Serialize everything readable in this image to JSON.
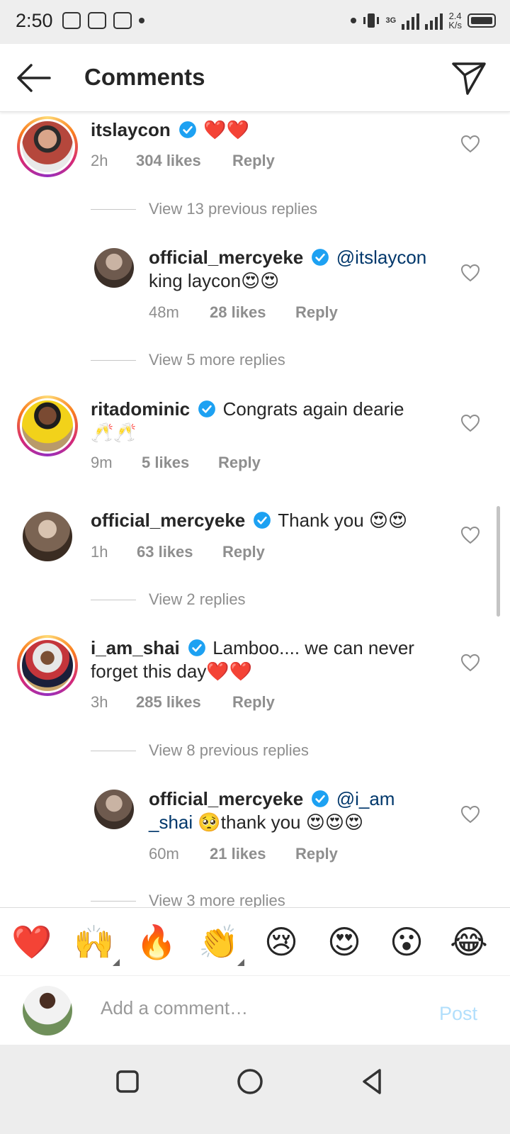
{
  "status": {
    "time": "2:50",
    "speed_value": "2.4",
    "speed_unit": "K/s",
    "network": "3G"
  },
  "header": {
    "title": "Comments"
  },
  "comments": [
    {
      "username": "itslaycon",
      "text": "❤️❤️",
      "time": "2h",
      "likes": "304 likes",
      "reply": "Reply"
    },
    {
      "username": "official_mercyeke",
      "mention": "@itslaycon",
      "text": "king laycon😍😍",
      "time": "48m",
      "likes": "28 likes",
      "reply": "Reply"
    },
    {
      "username": "ritadominic",
      "text": "Congrats again dearie",
      "text2": "🥂🥂",
      "time": "9m",
      "likes": "5 likes",
      "reply": "Reply"
    },
    {
      "username": "official_mercyeke",
      "text": "Thank you 😍😍",
      "time": "1h",
      "likes": "63 likes",
      "reply": "Reply"
    },
    {
      "username": "i_am_shai",
      "text": "Lamboo.... we can never",
      "text2": "forget this day❤️❤️",
      "time": "3h",
      "likes": "285 likes",
      "reply": "Reply"
    },
    {
      "username": "official_mercyeke",
      "mention": "@i_am",
      "mention2": "_shai",
      "text": "🥺thank you 😍😍😍",
      "time": "60m",
      "likes": "21 likes",
      "reply": "Reply"
    }
  ],
  "view_replies": [
    "View 13 previous replies",
    "View 5 more replies",
    "View 2 replies",
    "View 8 previous replies",
    "View 3 more replies"
  ],
  "emoji_bar": [
    "❤️",
    "🙌",
    "🔥",
    "👏",
    "😢",
    "😍",
    "😮",
    "😂"
  ],
  "composer": {
    "placeholder": "Add a comment…",
    "post_label": "Post"
  },
  "colors": {
    "verified": "#1da1f2",
    "mention": "#00376b",
    "meta": "#8e8e8e",
    "post_disabled": "#b2dffc"
  }
}
